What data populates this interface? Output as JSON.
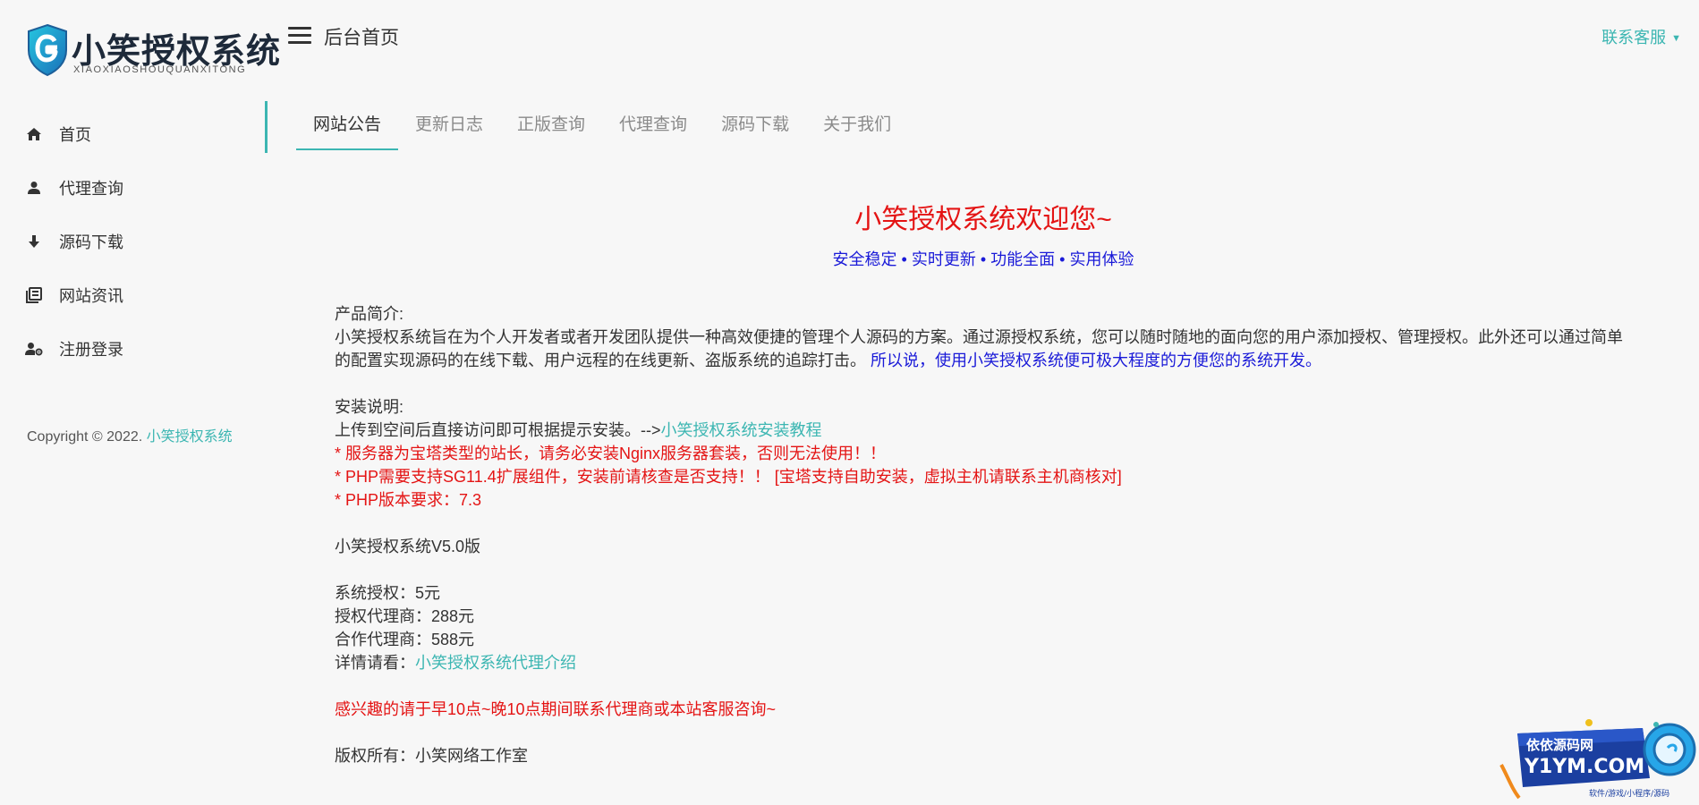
{
  "logo": {
    "title": "小笑授权系统",
    "subtitle": "XIAOXIAOSHOUQUANXITONG"
  },
  "sidebar": {
    "items": [
      {
        "label": "首页",
        "icon": "home-icon"
      },
      {
        "label": "代理查询",
        "icon": "user-icon"
      },
      {
        "label": "源码下载",
        "icon": "download-icon"
      },
      {
        "label": "网站资讯",
        "icon": "news-icon"
      },
      {
        "label": "注册登录",
        "icon": "user-settings-icon"
      }
    ],
    "copyright_prefix": "Copyright © 2022. ",
    "copyright_link": "小笑授权系统"
  },
  "header": {
    "title": "后台首页",
    "contact": "联系客服"
  },
  "tabs": [
    {
      "label": "网站公告",
      "active": true
    },
    {
      "label": "更新日志",
      "active": false
    },
    {
      "label": "正版查询",
      "active": false
    },
    {
      "label": "代理查询",
      "active": false
    },
    {
      "label": "源码下载",
      "active": false
    },
    {
      "label": "关于我们",
      "active": false
    }
  ],
  "announcement": {
    "welcome": "小笑授权系统欢迎您~",
    "slogan": "安全稳定 • 实时更新 • 功能全面 • 实用体验",
    "intro_heading": "产品简介:",
    "intro_text": "小笑授权系统旨在为个人开发者或者开发团队提供一种高效便捷的管理个人源码的方案。通过源授权系统，您可以随时随地的面向您的用户添加授权、管理授权。此外还可以通过简单的配置实现源码的在线下载、用户远程的在线更新、盗版系统的追踪打击。",
    "intro_highlight": "所以说，使用小笑授权系统便可极大程度的方便您的系统开发。",
    "install_heading": "安装说明:",
    "install_text": "上传到空间后直接访问即可根据提示安装。-->",
    "install_link": "小笑授权系统安装教程",
    "warning_1": "* 服务器为宝塔类型的站长，请务必安装Nginx服务器套装，否则无法使用！！",
    "warning_2": "* PHP需要支持SG11.4扩展组件，安装前请核查是否支持！！ [宝塔支持自助安装，虚拟主机请联系主机商核对]",
    "warning_3": "* PHP版本要求：7.3",
    "version": "小笑授权系统V5.0版",
    "price_1": "系统授权：5元",
    "price_2": "授权代理商：288元",
    "price_3": "合作代理商：588元",
    "details_prefix": "详情请看：",
    "details_link": "小笑授权系统代理介绍",
    "contact_note": "感兴趣的请于早10点~晚10点期间联系代理商或本站客服咨询~",
    "rights": "版权所有：小笑网络工作室"
  },
  "watermark": {
    "line1": "依依源码网",
    "line2": "Y1YM.COM",
    "line3": "软件/游戏/小程序/源码"
  },
  "colors": {
    "accent": "#3cb6b2",
    "red": "#e41414",
    "blue": "#1a1ad8",
    "background": "#f7f7f7"
  }
}
